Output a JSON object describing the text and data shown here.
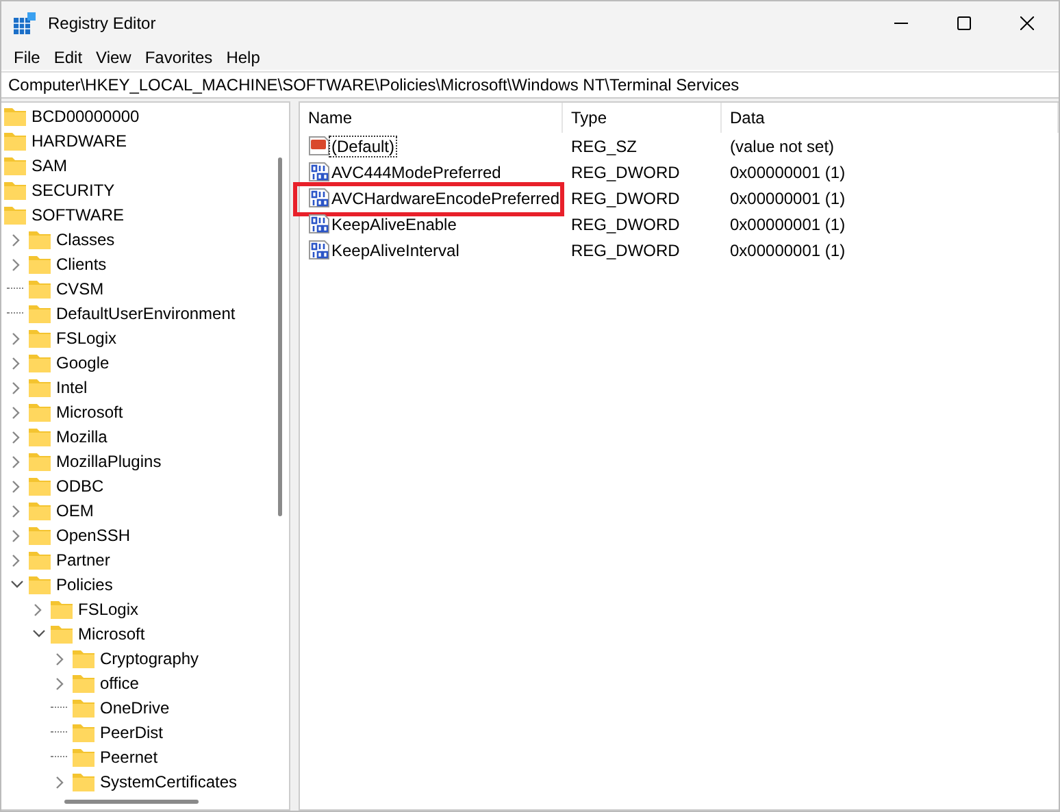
{
  "window": {
    "title": "Registry Editor"
  },
  "menu": [
    {
      "label": "File"
    },
    {
      "label": "Edit"
    },
    {
      "label": "View"
    },
    {
      "label": "Favorites"
    },
    {
      "label": "Help"
    }
  ],
  "address": "Computer\\HKEY_LOCAL_MACHINE\\SOFTWARE\\Policies\\Microsoft\\Windows NT\\Terminal Services",
  "tree": [
    {
      "label": "BCD00000000"
    },
    {
      "label": "HARDWARE"
    },
    {
      "label": "SAM"
    },
    {
      "label": "SECURITY"
    },
    {
      "label": "SOFTWARE",
      "children": [
        {
          "label": "Classes",
          "expanded": false
        },
        {
          "label": "Clients",
          "expanded": false
        },
        {
          "label": "CVSM"
        },
        {
          "label": "DefaultUserEnvironment"
        },
        {
          "label": "FSLogix",
          "expanded": false
        },
        {
          "label": "Google",
          "expanded": false
        },
        {
          "label": "Intel",
          "expanded": false
        },
        {
          "label": "Microsoft",
          "expanded": false
        },
        {
          "label": "Mozilla",
          "expanded": false
        },
        {
          "label": "MozillaPlugins",
          "expanded": false
        },
        {
          "label": "ODBC",
          "expanded": false
        },
        {
          "label": "OEM",
          "expanded": false
        },
        {
          "label": "OpenSSH",
          "expanded": false
        },
        {
          "label": "Partner",
          "expanded": false
        },
        {
          "label": "Policies",
          "expanded": true,
          "children": [
            {
              "label": "FSLogix",
              "expanded": false
            },
            {
              "label": "Microsoft",
              "expanded": true,
              "children": [
                {
                  "label": "Cryptography",
                  "expanded": false
                },
                {
                  "label": "office",
                  "expanded": false
                },
                {
                  "label": "OneDrive"
                },
                {
                  "label": "PeerDist"
                },
                {
                  "label": "Peernet"
                },
                {
                  "label": "SystemCertificates",
                  "expanded": false
                }
              ]
            }
          ]
        }
      ]
    }
  ],
  "table": {
    "columns": [
      "Name",
      "Type",
      "Data"
    ],
    "rows": [
      {
        "kind": "string",
        "name": "(Default)",
        "type": "REG_SZ",
        "data": "(value not set)",
        "focused": true,
        "highlighted": false
      },
      {
        "kind": "dword",
        "name": "AVC444ModePreferred",
        "type": "REG_DWORD",
        "data": "0x00000001 (1)",
        "focused": false,
        "highlighted": false
      },
      {
        "kind": "dword",
        "name": "AVCHardwareEncodePreferred",
        "type": "REG_DWORD",
        "data": "0x00000001 (1)",
        "focused": false,
        "highlighted": true
      },
      {
        "kind": "dword",
        "name": "KeepAliveEnable",
        "type": "REG_DWORD",
        "data": "0x00000001 (1)",
        "focused": false,
        "highlighted": false
      },
      {
        "kind": "dword",
        "name": "KeepAliveInterval",
        "type": "REG_DWORD",
        "data": "0x00000001 (1)",
        "focused": false,
        "highlighted": false
      }
    ]
  }
}
